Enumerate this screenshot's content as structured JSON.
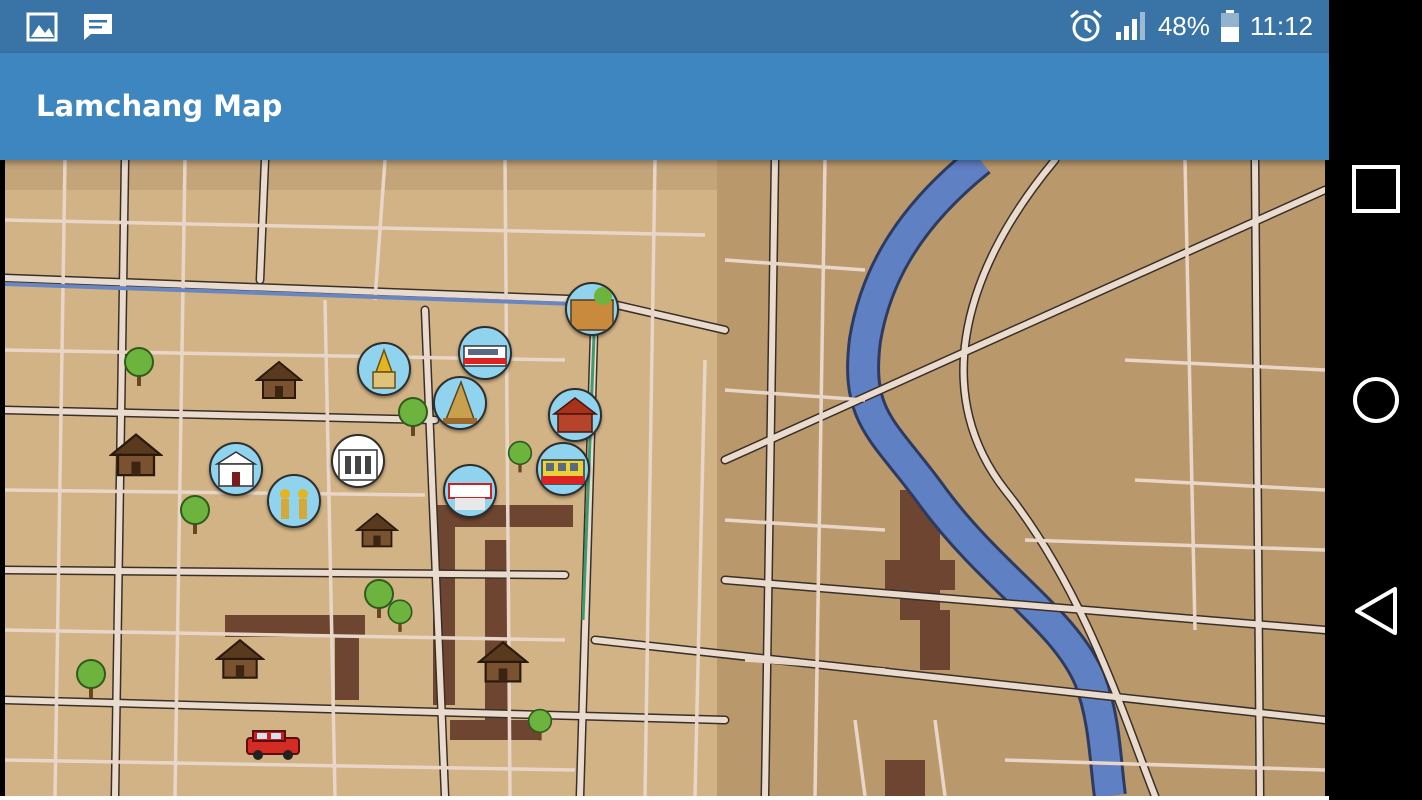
{
  "status_bar": {
    "battery": "48%",
    "time": "11:12",
    "icons": [
      "image-icon",
      "message-icon",
      "alarm-icon",
      "signal-icon",
      "battery-icon"
    ]
  },
  "app_bar": {
    "title": "Lamchang Map"
  },
  "map": {
    "pins": [
      "temple-pin",
      "bus-pin",
      "chedi-pin",
      "wooden-house-pin",
      "fort-pin",
      "museum-pin",
      "white-building-pin",
      "dancers-pin",
      "sign-pin",
      "train-pin"
    ],
    "markers": [
      "tree-icon",
      "house-icon",
      "red-car-icon"
    ]
  },
  "nav": {
    "buttons": [
      "recents-button",
      "home-button",
      "back-button"
    ]
  },
  "colors": {
    "status": "#3a74a6",
    "app_bar": "#3e86bf",
    "map_land": "#d2b385",
    "road": "#ead8cc",
    "river": "#5f7fc0"
  }
}
